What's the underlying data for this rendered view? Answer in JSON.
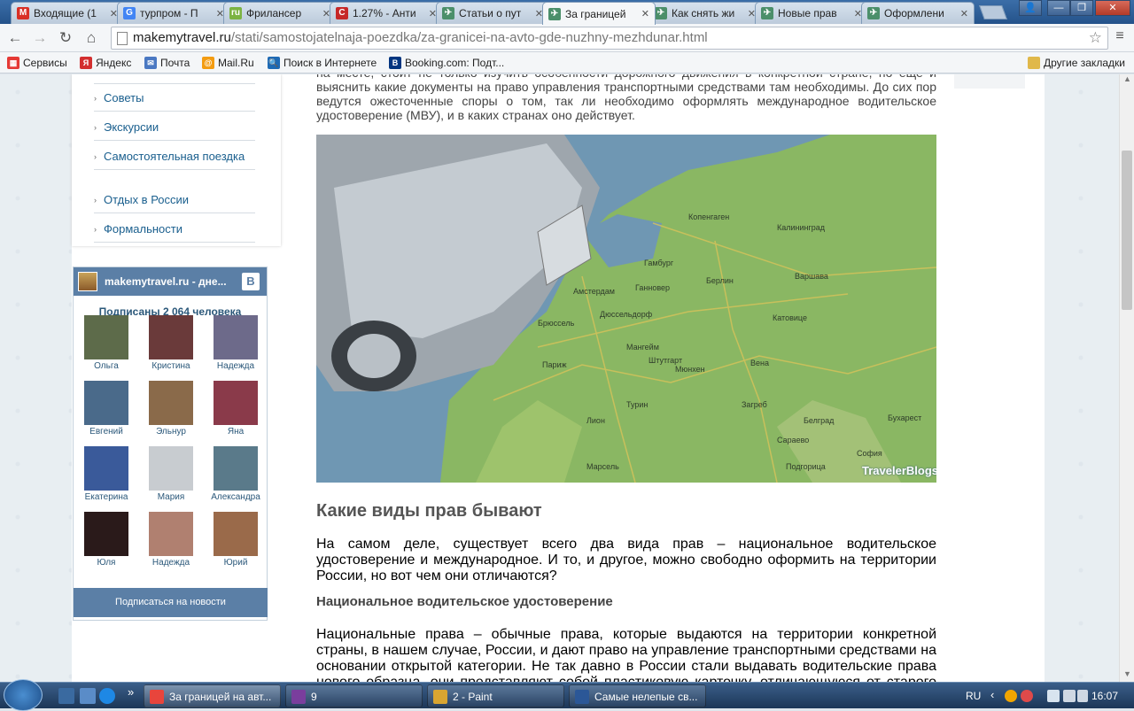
{
  "tabs": [
    {
      "title": "Входящие (1",
      "icon": "gmail-icon",
      "color": "#d93025",
      "glyph": "M"
    },
    {
      "title": "турпром - П",
      "icon": "google-icon",
      "color": "#4285f4",
      "glyph": "G"
    },
    {
      "title": "Фрилансер",
      "icon": "freelancer-icon",
      "color": "#7cb342",
      "glyph": "ru"
    },
    {
      "title": "1.27% - Анти",
      "icon": "antiplagiat-icon",
      "color": "#c62828",
      "glyph": "C"
    },
    {
      "title": "Статьи о пут",
      "icon": "site-icon",
      "color": "#4b8f6a",
      "glyph": "✈"
    },
    {
      "title": "За границей",
      "icon": "site-icon",
      "color": "#4b8f6a",
      "glyph": "✈",
      "active": true
    },
    {
      "title": "Как снять жи",
      "icon": "site-icon",
      "color": "#4b8f6a",
      "glyph": "✈"
    },
    {
      "title": "Новые прав",
      "icon": "site-icon",
      "color": "#4b8f6a",
      "glyph": "✈"
    },
    {
      "title": "Оформлени",
      "icon": "site-icon",
      "color": "#4b8f6a",
      "glyph": "✈"
    }
  ],
  "tab_close": "✕",
  "window": {
    "user": "👤",
    "minimize": "—",
    "restore": "❐",
    "close": "✕"
  },
  "toolbar": {
    "back": "←",
    "forward": "→",
    "reload": "↻",
    "home": "⌂",
    "menu": "≡",
    "star": "☆"
  },
  "url": {
    "host": "makemytravel.ru",
    "path": "/stati/samostojatelnaja-poezdka/za-granicei-na-avto-gde-nuzhny-mezhdunar.html"
  },
  "bookmarks": [
    {
      "label": "Сервисы",
      "icon": "apps-icon",
      "color": "#e53935",
      "glyph": "▦"
    },
    {
      "label": "Яндекс",
      "icon": "yandex-icon",
      "color": "#d32f2f",
      "glyph": "Я"
    },
    {
      "label": "Почта",
      "icon": "mail-icon",
      "color": "#4a78c2",
      "glyph": "✉"
    },
    {
      "label": "Mail.Ru",
      "icon": "mailru-icon",
      "color": "#f39c12",
      "glyph": "@"
    },
    {
      "label": "Поиск в Интернете",
      "icon": "search-icon",
      "color": "#1e6ab4",
      "glyph": "🔍"
    },
    {
      "label": "Booking.com: Подт...",
      "icon": "booking-icon",
      "color": "#003580",
      "glyph": "B"
    }
  ],
  "other_bookmarks": "Другие закладки",
  "categories": [
    "Советы",
    "Экскурсии",
    "Самостоятельная поездка",
    "Отдых в России",
    "Формальности"
  ],
  "vk": {
    "title": "makemytravel.ru - дне...",
    "logo_letter": "В",
    "subscribers": "Подписаны 2 064 человека",
    "button": "Подписаться на новости",
    "members": [
      "Ольга",
      "Кристина",
      "Надежда",
      "Евгений",
      "Эльнур",
      "Яна",
      "Екатерина",
      "Мария",
      "Александра",
      "Юля",
      "Надежда",
      "Юрий"
    ]
  },
  "article": {
    "intro": "на месте, стоит не только изучить особенности дорожного движения в конкретной стране, но еще и выяснить какие документы на право управления транспортными средствами там необходимы. До сих пор ведутся ожесточенные споры о том, так ли необходимо оформлять международное водительское удостоверение (МВУ), и в каких странах оно действует.",
    "map_cities": [
      "Копенгаген",
      "Калининград",
      "Гамбург",
      "Берлин",
      "Варшава",
      "Амстердам",
      "Ганновер",
      "Брюссель",
      "Дюссельдорф",
      "Катовице",
      "Париж",
      "Мангейм",
      "Штутгарт",
      "Мюнхен",
      "Вена",
      "Лион",
      "Турин",
      "Загреб",
      "Белград",
      "Бухарест",
      "Сараево",
      "София",
      "Марсель",
      "Подгорица"
    ],
    "watermark": "TravelerBlogs",
    "h2": "Какие виды прав бывают",
    "p1": "На самом деле, существует всего два вида прав – национальное водительское удостоверение и международное. И то, и другое, можно свободно оформить на территории России, но вот чем они отличаются?",
    "h3": "Национальное водительское удостоверение",
    "p2": "Национальные права – обычные права, которые выдаются на территории конкретной страны, в нашем случае, России, и дают право на управление транспортными средствами на основании открытой категории. Не так давно в России стали выдавать водительские права нового образца, они представляют собой пластиковую карточку, отличающуюся от старого варианта приятным розовым"
  },
  "taskbar": {
    "quick_more": "»",
    "items": [
      {
        "label": "За границей на авт...",
        "icon": "chrome-icon",
        "color": "#e8453c"
      },
      {
        "label": "9",
        "icon": "winrar-icon",
        "color": "#7a3e9d"
      },
      {
        "label": "2 - Paint",
        "icon": "paint-icon",
        "color": "#d9a531"
      },
      {
        "label": "Самые нелепые св...",
        "icon": "word-icon",
        "color": "#2b5797"
      }
    ],
    "lang": "RU",
    "tray_chevron": "‹",
    "time": "16:07"
  }
}
